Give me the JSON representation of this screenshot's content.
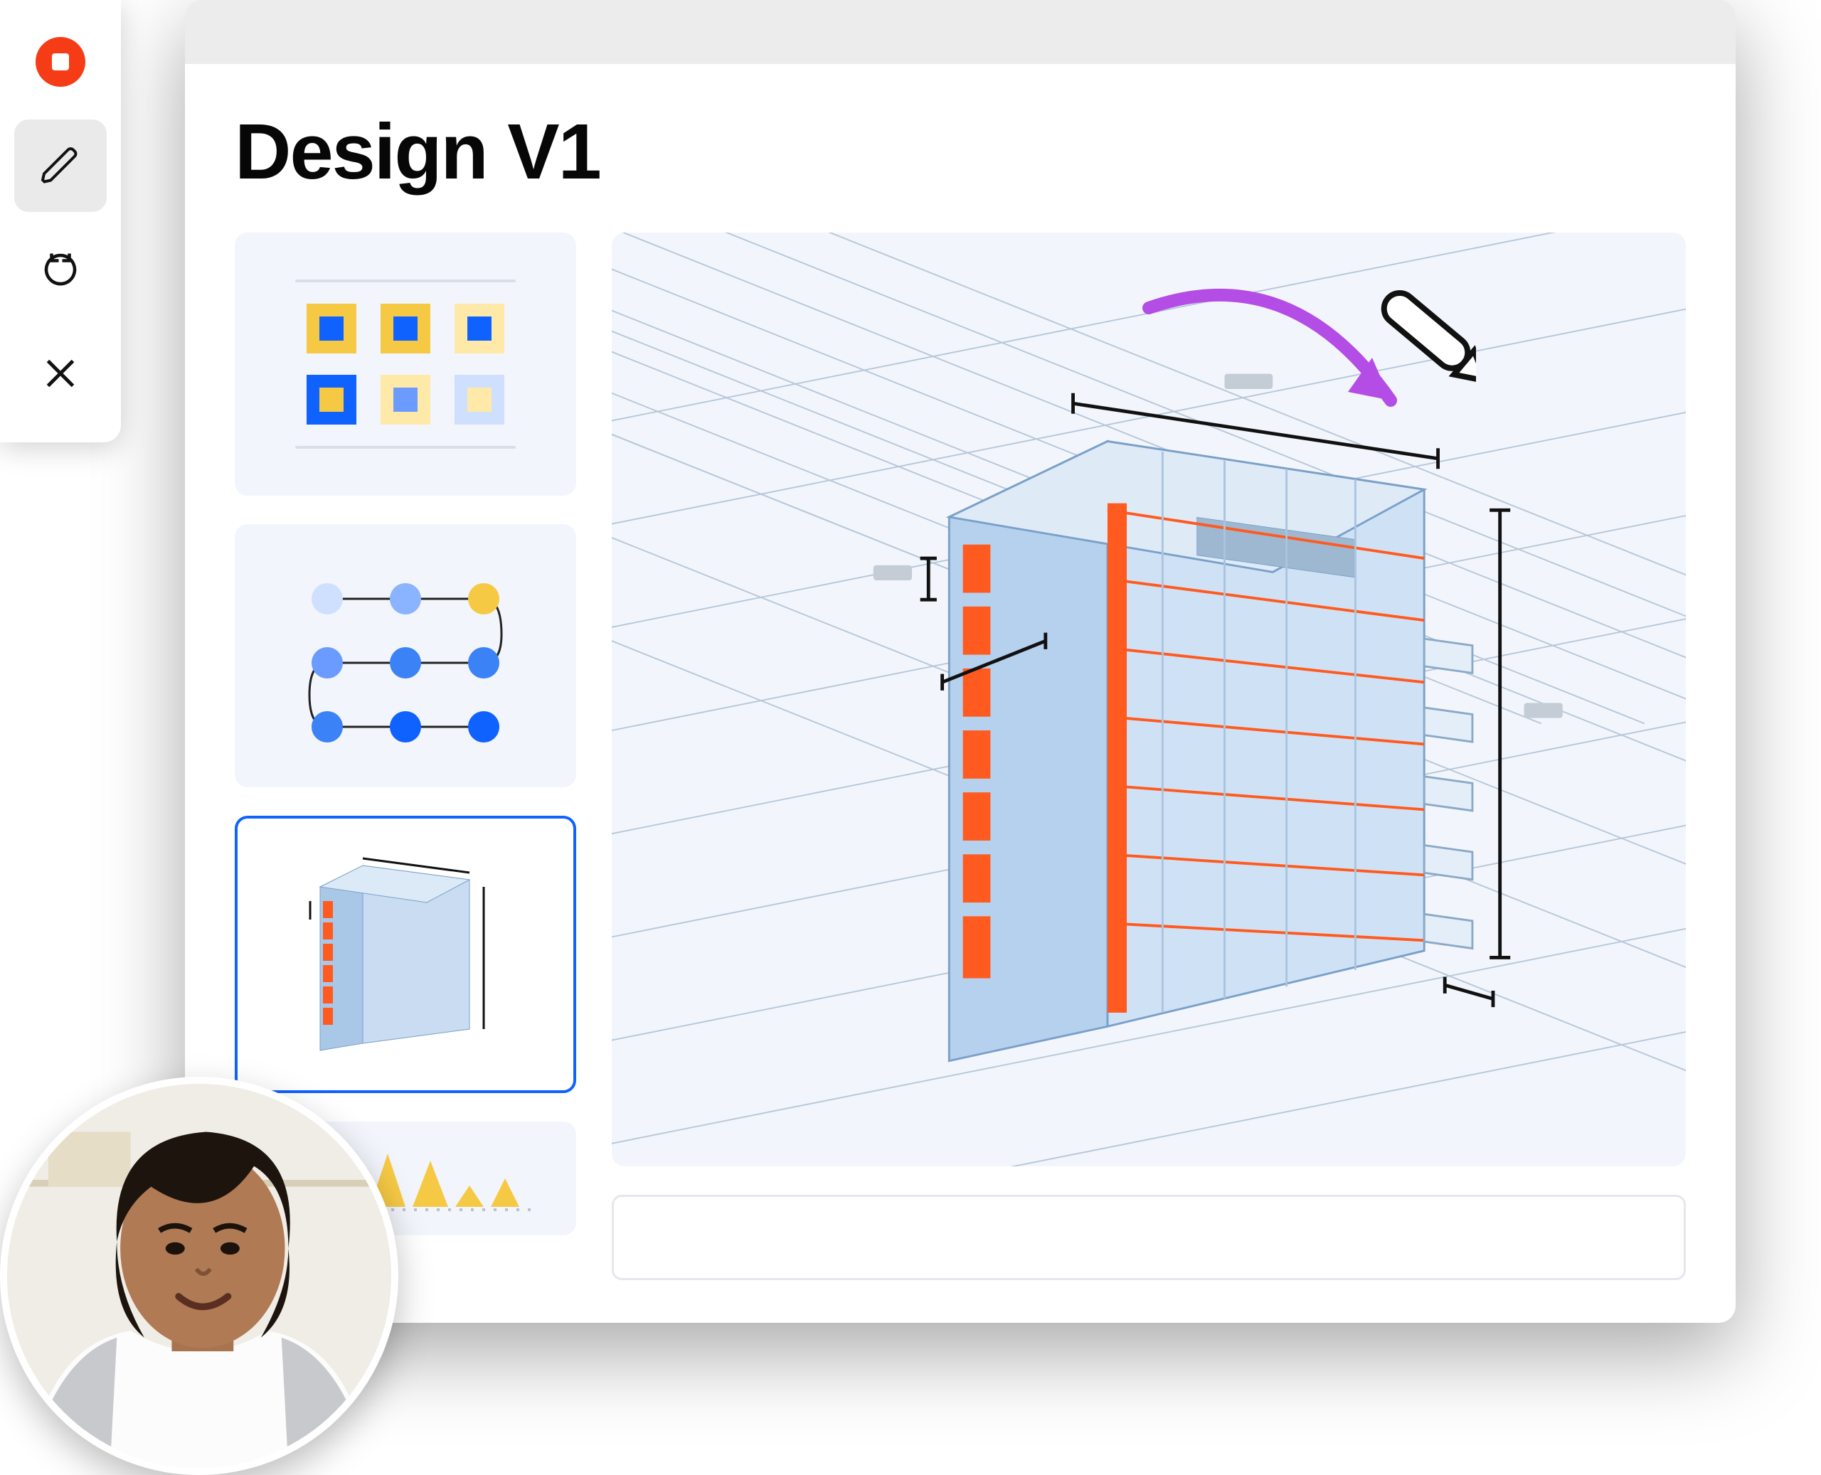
{
  "page": {
    "title": "Design V1"
  },
  "toolbar": {
    "items": [
      {
        "name": "record",
        "icon": "record-stop-icon",
        "selected": false
      },
      {
        "name": "draw",
        "icon": "pencil-icon",
        "selected": true
      },
      {
        "name": "redo",
        "icon": "redo-icon",
        "selected": false
      },
      {
        "name": "close",
        "icon": "close-icon",
        "selected": false
      }
    ]
  },
  "thumbnails": [
    {
      "name": "swatches",
      "selected": false,
      "desc": "color swatch grid"
    },
    {
      "name": "flow",
      "selected": false,
      "desc": "dot flow diagram"
    },
    {
      "name": "building-3d",
      "selected": true,
      "desc": "3d building isometric"
    },
    {
      "name": "bar-chart",
      "selected": false,
      "desc": "yellow bar chart"
    }
  ],
  "canvas": {
    "type": "3d-building-isometric",
    "annotation": "purple-arrow-with-pencil"
  },
  "avatar": {
    "alt": "presenter webcam"
  },
  "colors": {
    "accent": "#0f62fe",
    "orange": "#ff5a1f",
    "purple": "#b34de6",
    "yellow": "#f6c945",
    "panel": "#f2f5fb",
    "record": "#f63c17"
  }
}
